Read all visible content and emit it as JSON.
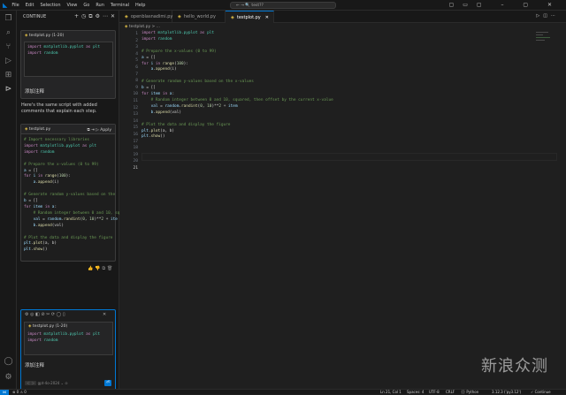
{
  "window": {
    "search": "← →   🔍   test??"
  },
  "menu": [
    "File",
    "Edit",
    "Selection",
    "View",
    "Go",
    "Run",
    "Terminal",
    "Help"
  ],
  "sidebar": {
    "title": "CONTINUE",
    "card1": {
      "file": "testplot.py (1-20)",
      "code": [
        "import matplotlib.pyplot as plt",
        "import random"
      ],
      "label": "添加注释"
    },
    "message": "Here's the same script with added comments that explain each step.",
    "card2": {
      "file": "testplot.py",
      "apply": "Apply"
    },
    "card3": {
      "file": "testplot.py (1-20)",
      "code": [
        "import matplotlib.pyplot as plt",
        "import random"
      ],
      "label": "添加注释",
      "model": "gpt-4o-2024 ⌄",
      "send": "⏎"
    }
  },
  "tabs": [
    "openblasnadimi.py",
    "hello_world.py",
    "testplot.py"
  ],
  "breadcrumb": "testplot.py > ...",
  "status": {
    "left": "⊗ 0 ⚠ 0",
    "pos": "Ln 21, Col 1",
    "spaces": "Spaces: 4",
    "enc": "UTF-8",
    "eol": "CRLF",
    "lang": "{} Python",
    "py": "3.12.3 ('py3.12')",
    "cont": "✓ Continue"
  }
}
